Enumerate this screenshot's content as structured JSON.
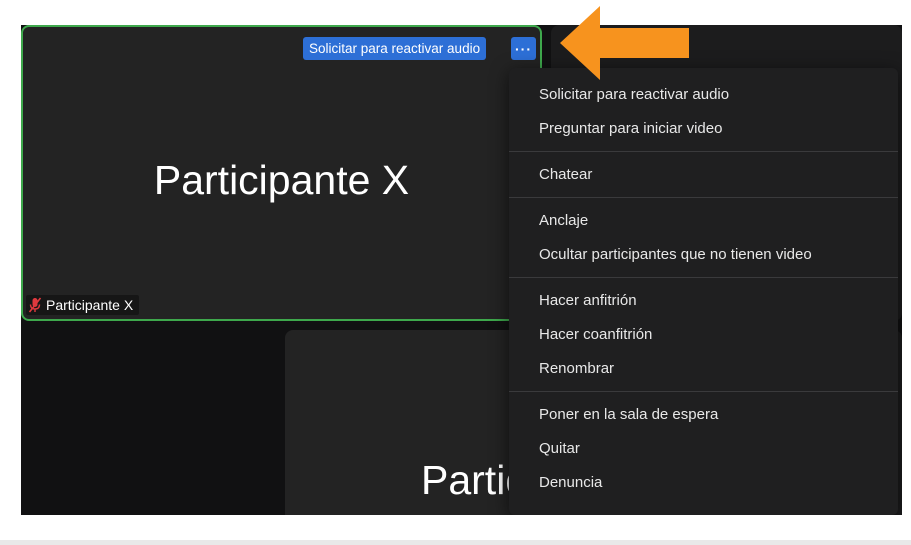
{
  "participant_tile": {
    "display_name": "Participante X",
    "name_tag": "Participante X",
    "request_audio_button": "Solicitar para reactivar audio",
    "more_button_icon": "ellipsis-icon",
    "more_button_label": "···",
    "muted_icon": "mic-muted-icon"
  },
  "second_tile": {
    "display_name": "Partic"
  },
  "context_menu": {
    "group1": [
      {
        "label": "Solicitar para reactivar audio"
      },
      {
        "label": "Preguntar para iniciar video"
      }
    ],
    "group2": [
      {
        "label": "Chatear"
      }
    ],
    "group3": [
      {
        "label": "Anclaje"
      },
      {
        "label": "Ocultar participantes que no tienen video"
      }
    ],
    "group4": [
      {
        "label": "Hacer anfitrión"
      },
      {
        "label": "Hacer coanfitrión"
      },
      {
        "label": "Renombrar"
      }
    ],
    "group5": [
      {
        "label": "Poner en la sala de espera"
      },
      {
        "label": "Quitar"
      },
      {
        "label": "Denuncia"
      }
    ]
  },
  "annotation": {
    "arrow_icon": "left-arrow-icon",
    "arrow_color": "#f7931e"
  },
  "colors": {
    "active_speaker_border": "#3ea84c",
    "button_blue": "#2d6fd6",
    "tile_background": "#232323"
  }
}
